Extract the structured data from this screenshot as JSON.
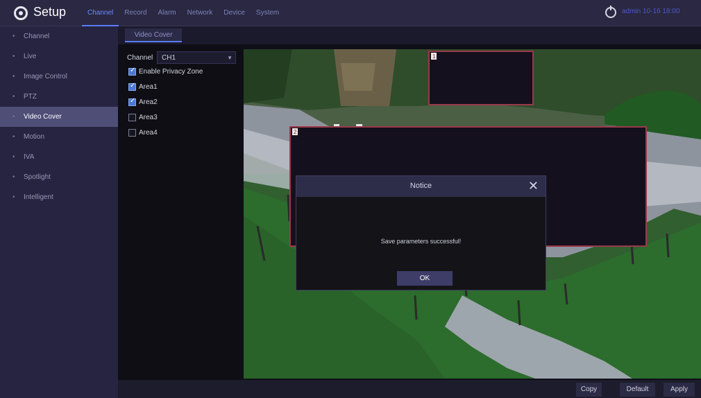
{
  "app": {
    "title": "Setup",
    "logo_icon": "gear-circle-icon"
  },
  "nav": {
    "items": [
      {
        "label": "Channel",
        "active": true
      },
      {
        "label": "Record",
        "active": false
      },
      {
        "label": "Alarm",
        "active": false
      },
      {
        "label": "Network",
        "active": false
      },
      {
        "label": "Device",
        "active": false
      },
      {
        "label": "System",
        "active": false
      }
    ],
    "power_icon": "power-icon",
    "user_text": "admin 10-16 18:00",
    "accent_color": "#5a7dff"
  },
  "sidebar": {
    "items": [
      {
        "label": "Channel",
        "active": false
      },
      {
        "label": "Live",
        "active": false
      },
      {
        "label": "Image Control",
        "active": false
      },
      {
        "label": "PTZ",
        "active": false
      },
      {
        "label": "Video Cover",
        "active": true
      },
      {
        "label": "Motion",
        "active": false
      },
      {
        "label": "IVA",
        "active": false
      },
      {
        "label": "Spotlight",
        "active": false
      },
      {
        "label": "Intelligent",
        "active": false
      }
    ]
  },
  "main": {
    "subtab": "Video Cover",
    "channel": {
      "label": "Channel",
      "value": "CH1"
    },
    "checkboxes": [
      {
        "label": "Enable Privacy Zone",
        "checked": true
      },
      {
        "label": "Area1",
        "checked": true
      },
      {
        "label": "Area2",
        "checked": true
      },
      {
        "label": "Area3",
        "checked": false
      },
      {
        "label": "Area4",
        "checked": false
      }
    ],
    "zones": [
      {
        "label": "1"
      },
      {
        "label": "2"
      }
    ],
    "buttons": {
      "copy": "Copy",
      "default": "Default",
      "apply": "Apply"
    }
  },
  "notice": {
    "title": "Notice",
    "message": "Save parameters successful!",
    "ok": "OK",
    "close_icon": "close-icon"
  }
}
